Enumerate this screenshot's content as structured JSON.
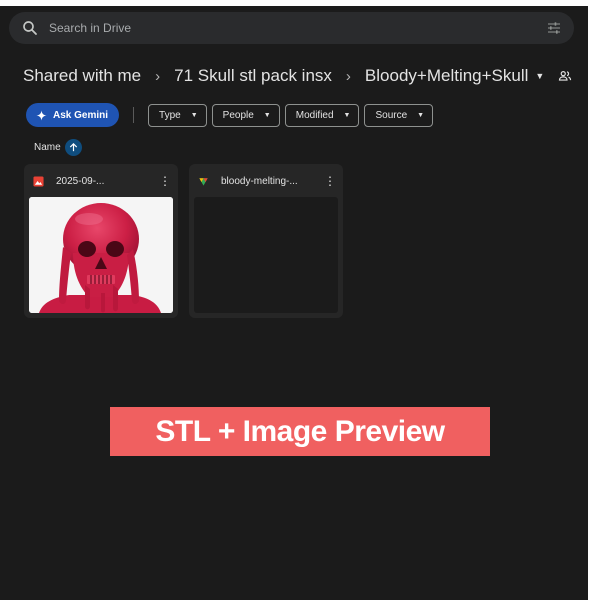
{
  "search": {
    "placeholder": "Search in Drive"
  },
  "breadcrumb": {
    "items": [
      "Shared with me",
      "71 Skull stl pack insx",
      "Bloody+Melting+Skull"
    ],
    "separator": "›"
  },
  "toolbar": {
    "gemini_label": "Ask Gemini",
    "filters": [
      "Type",
      "People",
      "Modified",
      "Source"
    ]
  },
  "sort": {
    "label": "Name",
    "direction": "ascending"
  },
  "files": [
    {
      "name": "2025-09-...",
      "icon": "image-file-icon",
      "icon_color": "#e94235",
      "preview": "red-melting-skull-image"
    },
    {
      "name": "bloody-melting-...",
      "icon": "stl-file-icon",
      "icon_color": "#34a853",
      "preview": "blank"
    }
  ],
  "banner": {
    "text": "STL + Image Preview",
    "color": "#f06060"
  },
  "colors": {
    "background": "#1b1b1b",
    "accent": "#1f54b3",
    "skull": "#d2264b"
  }
}
